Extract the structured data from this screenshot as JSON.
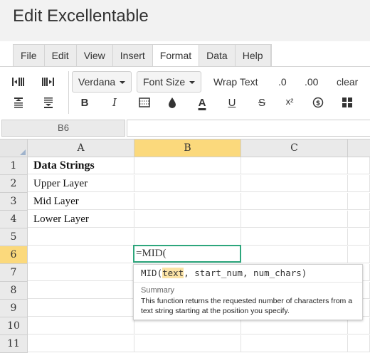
{
  "app": {
    "title": "Edit Excellentable"
  },
  "menu": {
    "tabs": [
      "File",
      "Edit",
      "View",
      "Insert",
      "Format",
      "Data",
      "Help"
    ],
    "active": "Format"
  },
  "toolbar": {
    "font_family": "Verdana",
    "font_size": "Font Size",
    "wrap_text": "Wrap Text",
    "dec_decrease": ".0",
    "dec_increase": ".00",
    "clear": "clear",
    "bold": "B",
    "italic": "I",
    "text_color": "A",
    "underline": "U",
    "strike": "S",
    "superscript": "x²"
  },
  "namebox": "B6",
  "columns": [
    "A",
    "B",
    "C"
  ],
  "selected_column": "B",
  "rows": [
    "1",
    "2",
    "3",
    "4",
    "5",
    "6",
    "7",
    "8",
    "9",
    "10",
    "11"
  ],
  "selected_row": "6",
  "cells": {
    "A1": "Data Strings",
    "A2": "Upper Layer",
    "A3": "Mid Layer",
    "A4": "Lower Layer"
  },
  "editor_value": "=MID(",
  "autocomplete": {
    "fn": "MID(",
    "param_active": "text",
    "params_rest": ", start_num, num_chars)",
    "summary_heading": "Summary",
    "summary": "This function returns the requested number of characters from a text string starting at the position you specify."
  },
  "colors": {
    "selection_header": "#fbd97c",
    "active_border": "#2da67c",
    "header_bg": "#eaeaea"
  }
}
